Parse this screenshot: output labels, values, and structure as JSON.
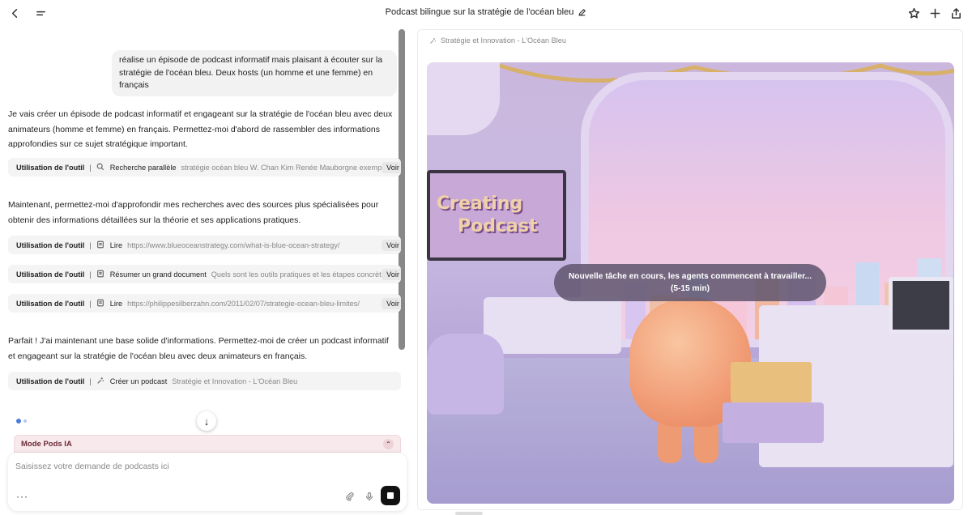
{
  "header": {
    "title": "Podcast bilingue sur la stratégie de l'océan bleu"
  },
  "icons": {
    "back": "back-icon",
    "menu": "menu-icon",
    "edit": "edit-icon",
    "star": "star-icon",
    "plus": "plus-icon",
    "share": "share-icon"
  },
  "chat": {
    "user_message": "réalise un épisode de podcast informatif mais plaisant à écouter sur la stratégie de l'océan bleu. Deux hosts (un homme et une femme) en français",
    "para1": "Je vais créer un épisode de podcast informatif et engageant sur la stratégie de l'océan bleu avec deux animateurs (homme et femme) en français. Permettez-moi d'abord de rassembler des informations approfondies sur ce sujet stratégique important.",
    "para2": "Maintenant, permettez-moi d'approfondir mes recherches avec des sources plus spécialisées pour obtenir des informations détaillées sur la théorie et ses applications pratiques.",
    "para3": "Parfait ! J'ai maintenant une base solide d'informations. Permettez-moi de créer un podcast informatif et engageant sur la stratégie de l'océan bleu avec deux animateurs en français.",
    "tools": [
      {
        "label": "Utilisation de l'outil",
        "sep": "|",
        "action": "Recherche parallèle",
        "detail": "stratégie océan bleu W. Chan Kim Renée Mauborgne exemp",
        "voir": "Voir"
      },
      {
        "label": "Utilisation de l'outil",
        "sep": "|",
        "action": "Lire",
        "detail": "https://www.blueoceanstrategy.com/what-is-blue-ocean-strategy/",
        "voir": "Voir"
      },
      {
        "label": "Utilisation de l'outil",
        "sep": "|",
        "action": "Résumer un grand document",
        "detail": "Quels sont les outils pratiques et les étapes concrèt",
        "voir": "Voir"
      },
      {
        "label": "Utilisation de l'outil",
        "sep": "|",
        "action": "Lire",
        "detail": "https://philippesilberzahn.com/2011/02/07/strategie-ocean-bleu-limites/",
        "voir": "Voir"
      },
      {
        "label": "Utilisation de l'outil",
        "sep": "|",
        "action": "Créer un podcast",
        "detail": "Stratégie et Innovation - L'Océan Bleu",
        "voir": ""
      }
    ],
    "scroll_down": "↓"
  },
  "mode_bar": {
    "label": "Mode Pods IA",
    "chevron": "⌃"
  },
  "composer": {
    "placeholder": "Saisissez votre demande de podcasts ici",
    "more": "···"
  },
  "preview": {
    "header": "Stratégie et Innovation - L'Océan Bleu",
    "tv_line1": "Creating",
    "tv_line2": "Podcast",
    "status_line1": "Nouvelle tâche en cours, les agents commencent à travailler...",
    "status_line2": "(5-15 min)"
  }
}
